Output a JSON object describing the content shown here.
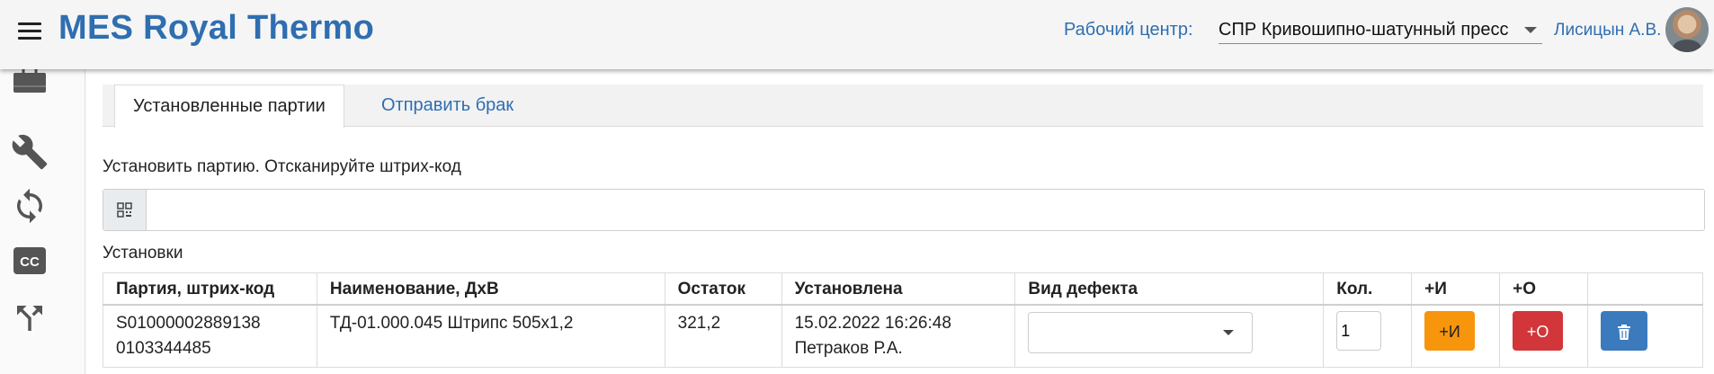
{
  "app": {
    "title": "MES Royal Thermo"
  },
  "header": {
    "work_center_label": "Рабочий центр:",
    "work_center_value": "СПР Кривошипно-шатунный пресс",
    "user_name": "Лисицын А.В."
  },
  "sidebar": {
    "icons": [
      "briefcase-icon",
      "wrench-icon",
      "refresh-icon",
      "cc-icon",
      "split-arrow-icon"
    ]
  },
  "tabs": [
    {
      "label": "Установленные партии",
      "active": true
    },
    {
      "label": "Отправить брак",
      "active": false
    }
  ],
  "scan": {
    "label": "Установить партию. Отсканируйте штрих-код",
    "value": "",
    "placeholder": ""
  },
  "installations": {
    "label": "Установки",
    "columns": [
      "Партия, штрих-код",
      "Наименование, ДхВ",
      "Остаток",
      "Установлена",
      "Вид дефекта",
      "Кол.",
      "+И",
      "+О",
      ""
    ],
    "rows": [
      {
        "batch": "S01000002889138",
        "barcode": "0103344485",
        "name": "ТД-01.000.045 Штрипс 505х1,2",
        "remainder": "321,2",
        "installed_at": "15.02.2022 16:26:48",
        "installed_by": "Петраков Р.А.",
        "defect_type": "",
        "qty": "1",
        "btn_i": "+И",
        "btn_o": "+О"
      }
    ]
  },
  "colors": {
    "brand": "#2f6eb0",
    "btn_i": "#f7950c",
    "btn_o": "#d2363a",
    "btn_delete": "#3a7abd"
  }
}
